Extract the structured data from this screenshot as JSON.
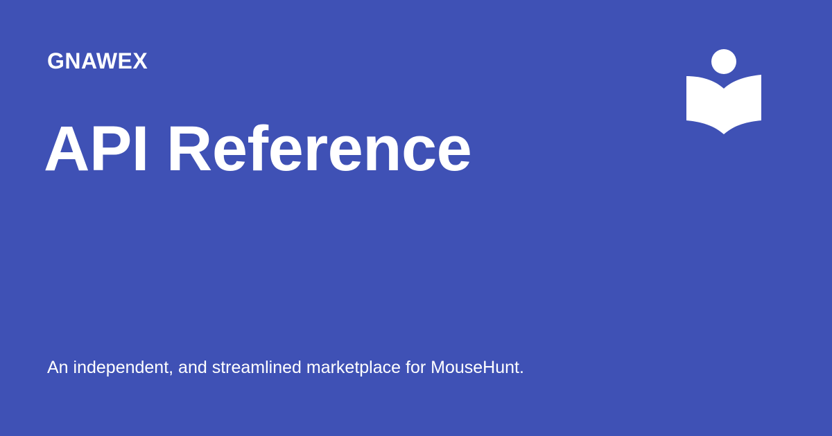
{
  "header": {
    "site_name": "GNAWEX"
  },
  "main": {
    "title": "API Reference",
    "description": "An independent, and streamlined marketplace for MouseHunt."
  },
  "logo": {
    "icon": "reader-book-icon"
  },
  "colors": {
    "background": "#3f51b5",
    "text": "#ffffff"
  }
}
